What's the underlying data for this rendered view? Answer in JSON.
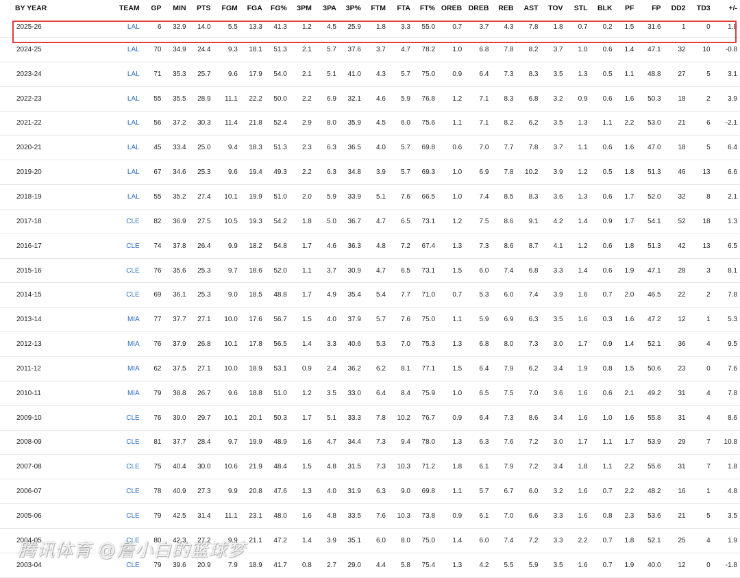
{
  "columns": [
    "BY YEAR",
    "TEAM",
    "GP",
    "MIN",
    "PTS",
    "FGM",
    "FGA",
    "FG%",
    "3PM",
    "3PA",
    "3P%",
    "FTM",
    "FTA",
    "FT%",
    "OREB",
    "DREB",
    "REB",
    "AST",
    "TOV",
    "STL",
    "BLK",
    "PF",
    "FP",
    "DD2",
    "TD3",
    "+/-"
  ],
  "rows": [
    [
      "2025-26",
      "LAL",
      "6",
      "32.9",
      "14.0",
      "5.5",
      "13.3",
      "41.3",
      "1.2",
      "4.5",
      "25.9",
      "1.8",
      "3.3",
      "55.0",
      "0.7",
      "3.7",
      "4.3",
      "7.8",
      "1.8",
      "0.7",
      "0.2",
      "1.5",
      "31.6",
      "1",
      "0",
      "1.8"
    ],
    [
      "2024-25",
      "LAL",
      "70",
      "34.9",
      "24.4",
      "9.3",
      "18.1",
      "51.3",
      "2.1",
      "5.7",
      "37.6",
      "3.7",
      "4.7",
      "78.2",
      "1.0",
      "6.8",
      "7.8",
      "8.2",
      "3.7",
      "1.0",
      "0.6",
      "1.4",
      "47.1",
      "32",
      "10",
      "-0.8"
    ],
    [
      "2023-24",
      "LAL",
      "71",
      "35.3",
      "25.7",
      "9.6",
      "17.9",
      "54.0",
      "2.1",
      "5.1",
      "41.0",
      "4.3",
      "5.7",
      "75.0",
      "0.9",
      "6.4",
      "7.3",
      "8.3",
      "3.5",
      "1.3",
      "0.5",
      "1.1",
      "48.8",
      "27",
      "5",
      "3.1"
    ],
    [
      "2022-23",
      "LAL",
      "55",
      "35.5",
      "28.9",
      "11.1",
      "22.2",
      "50.0",
      "2.2",
      "6.9",
      "32.1",
      "4.6",
      "5.9",
      "76.8",
      "1.2",
      "7.1",
      "8.3",
      "6.8",
      "3.2",
      "0.9",
      "0.6",
      "1.6",
      "50.3",
      "18",
      "2",
      "3.9"
    ],
    [
      "2021-22",
      "LAL",
      "56",
      "37.2",
      "30.3",
      "11.4",
      "21.8",
      "52.4",
      "2.9",
      "8.0",
      "35.9",
      "4.5",
      "6.0",
      "75.6",
      "1.1",
      "7.1",
      "8.2",
      "6.2",
      "3.5",
      "1.3",
      "1.1",
      "2.2",
      "53.0",
      "21",
      "6",
      "-2.1"
    ],
    [
      "2020-21",
      "LAL",
      "45",
      "33.4",
      "25.0",
      "9.4",
      "18.3",
      "51.3",
      "2.3",
      "6.3",
      "36.5",
      "4.0",
      "5.7",
      "69.8",
      "0.6",
      "7.0",
      "7.7",
      "7.8",
      "3.7",
      "1.1",
      "0.6",
      "1.6",
      "47.0",
      "18",
      "5",
      "6.4"
    ],
    [
      "2019-20",
      "LAL",
      "67",
      "34.6",
      "25.3",
      "9.6",
      "19.4",
      "49.3",
      "2.2",
      "6.3",
      "34.8",
      "3.9",
      "5.7",
      "69.3",
      "1.0",
      "6.9",
      "7.8",
      "10.2",
      "3.9",
      "1.2",
      "0.5",
      "1.8",
      "51.3",
      "46",
      "13",
      "6.6"
    ],
    [
      "2018-19",
      "LAL",
      "55",
      "35.2",
      "27.4",
      "10.1",
      "19.9",
      "51.0",
      "2.0",
      "5.9",
      "33.9",
      "5.1",
      "7.6",
      "66.5",
      "1.0",
      "7.4",
      "8.5",
      "8.3",
      "3.6",
      "1.3",
      "0.6",
      "1.7",
      "52.0",
      "32",
      "8",
      "2.1"
    ],
    [
      "2017-18",
      "CLE",
      "82",
      "36.9",
      "27.5",
      "10.5",
      "19.3",
      "54.2",
      "1.8",
      "5.0",
      "36.7",
      "4.7",
      "6.5",
      "73.1",
      "1.2",
      "7.5",
      "8.6",
      "9.1",
      "4.2",
      "1.4",
      "0.9",
      "1.7",
      "54.1",
      "52",
      "18",
      "1.3"
    ],
    [
      "2016-17",
      "CLE",
      "74",
      "37.8",
      "26.4",
      "9.9",
      "18.2",
      "54.8",
      "1.7",
      "4.6",
      "36.3",
      "4.8",
      "7.2",
      "67.4",
      "1.3",
      "7.3",
      "8.6",
      "8.7",
      "4.1",
      "1.2",
      "0.6",
      "1.8",
      "51.3",
      "42",
      "13",
      "6.5"
    ],
    [
      "2015-16",
      "CLE",
      "76",
      "35.6",
      "25.3",
      "9.7",
      "18.6",
      "52.0",
      "1.1",
      "3.7",
      "30.9",
      "4.7",
      "6.5",
      "73.1",
      "1.5",
      "6.0",
      "7.4",
      "6.8",
      "3.3",
      "1.4",
      "0.6",
      "1.9",
      "47.1",
      "28",
      "3",
      "8.1"
    ],
    [
      "2014-15",
      "CLE",
      "69",
      "36.1",
      "25.3",
      "9.0",
      "18.5",
      "48.8",
      "1.7",
      "4.9",
      "35.4",
      "5.4",
      "7.7",
      "71.0",
      "0.7",
      "5.3",
      "6.0",
      "7.4",
      "3.9",
      "1.6",
      "0.7",
      "2.0",
      "46.5",
      "22",
      "2",
      "7.8"
    ],
    [
      "2013-14",
      "MIA",
      "77",
      "37.7",
      "27.1",
      "10.0",
      "17.6",
      "56.7",
      "1.5",
      "4.0",
      "37.9",
      "5.7",
      "7.6",
      "75.0",
      "1.1",
      "5.9",
      "6.9",
      "6.3",
      "3.5",
      "1.6",
      "0.3",
      "1.6",
      "47.2",
      "12",
      "1",
      "5.3"
    ],
    [
      "2012-13",
      "MIA",
      "76",
      "37.9",
      "26.8",
      "10.1",
      "17.8",
      "56.5",
      "1.4",
      "3.3",
      "40.6",
      "5.3",
      "7.0",
      "75.3",
      "1.3",
      "6.8",
      "8.0",
      "7.3",
      "3.0",
      "1.7",
      "0.9",
      "1.4",
      "52.1",
      "36",
      "4",
      "9.5"
    ],
    [
      "2011-12",
      "MIA",
      "62",
      "37.5",
      "27.1",
      "10.0",
      "18.9",
      "53.1",
      "0.9",
      "2.4",
      "36.2",
      "6.2",
      "8.1",
      "77.1",
      "1.5",
      "6.4",
      "7.9",
      "6.2",
      "3.4",
      "1.9",
      "0.8",
      "1.5",
      "50.6",
      "23",
      "0",
      "7.6"
    ],
    [
      "2010-11",
      "MIA",
      "79",
      "38.8",
      "26.7",
      "9.6",
      "18.8",
      "51.0",
      "1.2",
      "3.5",
      "33.0",
      "6.4",
      "8.4",
      "75.9",
      "1.0",
      "6.5",
      "7.5",
      "7.0",
      "3.6",
      "1.6",
      "0.6",
      "2.1",
      "49.2",
      "31",
      "4",
      "7.8"
    ],
    [
      "2009-10",
      "CLE",
      "76",
      "39.0",
      "29.7",
      "10.1",
      "20.1",
      "50.3",
      "1.7",
      "5.1",
      "33.3",
      "7.8",
      "10.2",
      "76.7",
      "0.9",
      "6.4",
      "7.3",
      "8.6",
      "3.4",
      "1.6",
      "1.0",
      "1.6",
      "55.8",
      "31",
      "4",
      "8.6"
    ],
    [
      "2008-09",
      "CLE",
      "81",
      "37.7",
      "28.4",
      "9.7",
      "19.9",
      "48.9",
      "1.6",
      "4.7",
      "34.4",
      "7.3",
      "9.4",
      "78.0",
      "1.3",
      "6.3",
      "7.6",
      "7.2",
      "3.0",
      "1.7",
      "1.1",
      "1.7",
      "53.9",
      "29",
      "7",
      "10.8"
    ],
    [
      "2007-08",
      "CLE",
      "75",
      "40.4",
      "30.0",
      "10.6",
      "21.9",
      "48.4",
      "1.5",
      "4.8",
      "31.5",
      "7.3",
      "10.3",
      "71.2",
      "1.8",
      "6.1",
      "7.9",
      "7.2",
      "3.4",
      "1.8",
      "1.1",
      "2.2",
      "55.6",
      "31",
      "7",
      "1.8"
    ],
    [
      "2006-07",
      "CLE",
      "78",
      "40.9",
      "27.3",
      "9.9",
      "20.8",
      "47.6",
      "1.3",
      "4.0",
      "31.9",
      "6.3",
      "9.0",
      "69.8",
      "1.1",
      "5.7",
      "6.7",
      "6.0",
      "3.2",
      "1.6",
      "0.7",
      "2.2",
      "48.2",
      "16",
      "1",
      "4.8"
    ],
    [
      "2005-06",
      "CLE",
      "79",
      "42.5",
      "31.4",
      "11.1",
      "23.1",
      "48.0",
      "1.6",
      "4.8",
      "33.5",
      "7.6",
      "10.3",
      "73.8",
      "0.9",
      "6.1",
      "7.0",
      "6.6",
      "3.3",
      "1.6",
      "0.8",
      "2.3",
      "53.6",
      "21",
      "5",
      "3.5"
    ],
    [
      "2004-05",
      "CLE",
      "80",
      "42.3",
      "27.2",
      "9.9",
      "21.1",
      "47.2",
      "1.4",
      "3.9",
      "35.1",
      "6.0",
      "8.0",
      "75.0",
      "1.4",
      "6.0",
      "7.4",
      "7.2",
      "3.3",
      "2.2",
      "0.7",
      "1.8",
      "52.1",
      "25",
      "4",
      "1.9"
    ],
    [
      "2003-04",
      "CLE",
      "79",
      "39.6",
      "20.9",
      "7.9",
      "18.9",
      "41.7",
      "0.8",
      "2.7",
      "29.0",
      "4.4",
      "5.8",
      "75.4",
      "1.3",
      "4.2",
      "5.5",
      "5.9",
      "3.5",
      "1.6",
      "0.7",
      "1.9",
      "40.0",
      "12",
      "0",
      "-1.8"
    ]
  ],
  "highlight_color": "#e23b3b",
  "team_link_color": "#2a6cc4",
  "watermark": "腾讯体育 @詹小白的篮球梦"
}
